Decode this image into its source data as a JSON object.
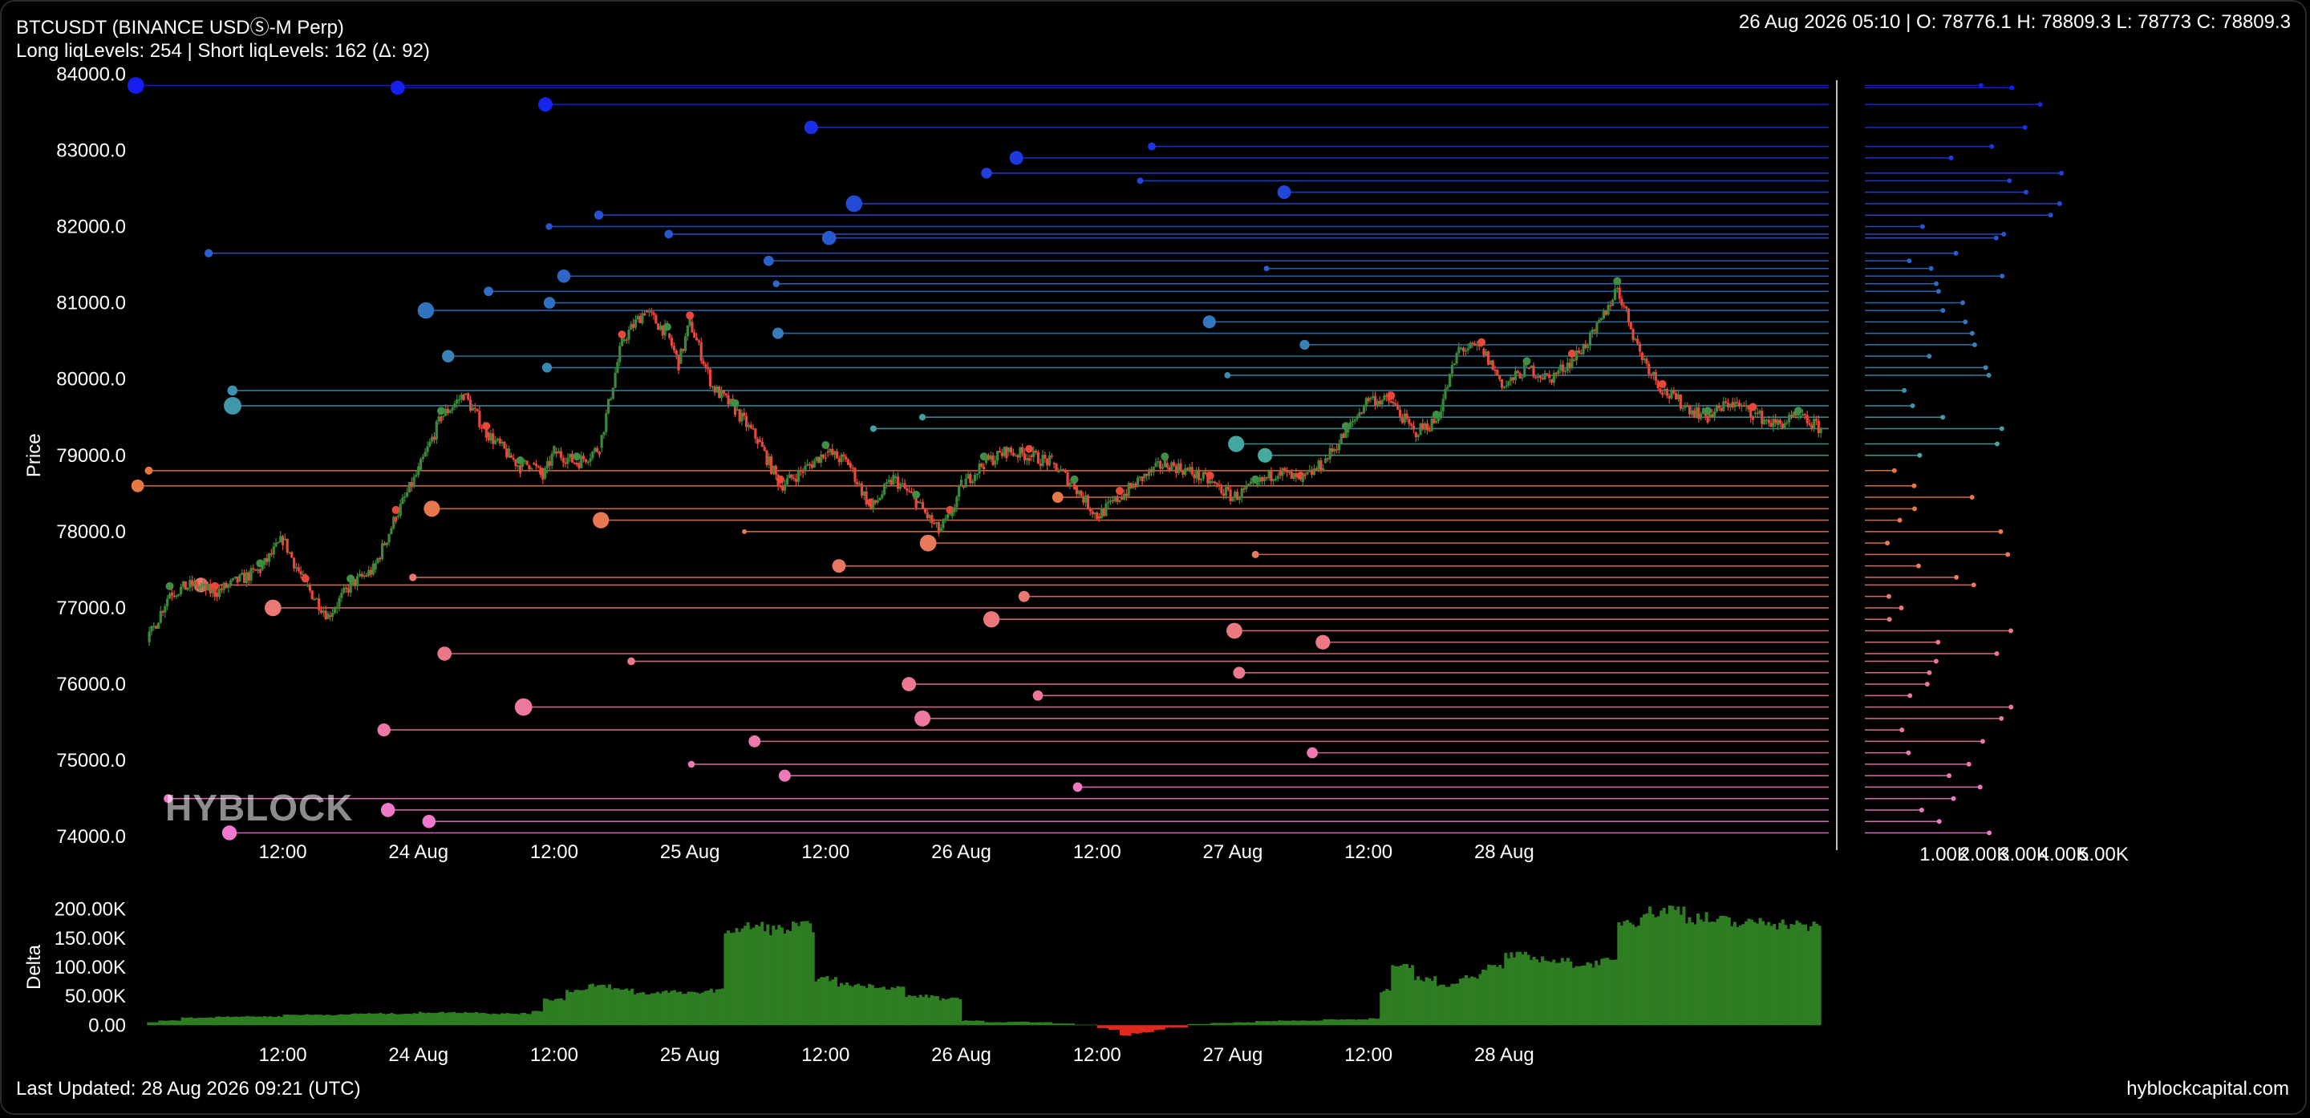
{
  "header": {
    "symbol": "BTCUSDT (BINANCE USDⓈ-M Perp)",
    "levels_summary": "Long liqLevels: 254 | Short liqLevels: 162 (Δ: 92)",
    "ohlc": "26 Aug 2026 05:10 | O: 78776.1 H: 78809.3 L: 78773 C: 78809.3"
  },
  "footer": {
    "last_updated": "Last Updated: 28 Aug 2026 09:21 (UTC)",
    "site": "hyblockcapital.com"
  },
  "watermark": "HYBLOCK",
  "colors": {
    "background": "#000000",
    "up_candle": "#3a8a3a",
    "down_candle": "#e8473a",
    "short_levels": "#1f2ee0",
    "long_levels": "#e88ab5",
    "delta_positive": "#2f7d23",
    "delta_negative": "#e0281c"
  },
  "chart_data": [
    {
      "type": "line",
      "title": "",
      "ylabel": "Price",
      "ylim": [
        73950,
        84150
      ],
      "y_ticks": [
        "84000.0",
        "83000.0",
        "82000.0",
        "81000.0",
        "80000.0",
        "79000.0",
        "78000.0",
        "77000.0",
        "76000.0",
        "75000.0",
        "74000.0"
      ],
      "x_ticks": [
        "12:00",
        "24 Aug",
        "12:00",
        "25 Aug",
        "12:00",
        "26 Aug",
        "12:00",
        "27 Aug",
        "12:00",
        "28 Aug"
      ],
      "x_tick_hours": [
        12,
        24,
        36,
        48,
        60,
        72,
        84,
        96,
        108,
        120
      ],
      "xlim_hours": [
        -1.3,
        148.7
      ],
      "series": [
        {
          "kind": "price",
          "x_hours": [
            0,
            2,
            4,
            6,
            8,
            10,
            12,
            14,
            16,
            18,
            20,
            22,
            24,
            26,
            28,
            30,
            32,
            33,
            34,
            35,
            36,
            38,
            40,
            42,
            44,
            46,
            47,
            48,
            50,
            52,
            54,
            56,
            58,
            60,
            62,
            64,
            66,
            68,
            70,
            71,
            72,
            74,
            76,
            78,
            80,
            82,
            84,
            86,
            88,
            90,
            92,
            94,
            96,
            98,
            100,
            102,
            104,
            106,
            108,
            110,
            112,
            114,
            116,
            118,
            120,
            122,
            124,
            126,
            128,
            130,
            132,
            134,
            136,
            138,
            140,
            142,
            144,
            146,
            148
          ],
          "y": [
            76550,
            77200,
            77300,
            77200,
            77350,
            77500,
            77900,
            77300,
            76900,
            77300,
            77500,
            78200,
            78800,
            79500,
            79800,
            79300,
            79000,
            78850,
            78900,
            78700,
            79050,
            78900,
            79100,
            80500,
            80900,
            80600,
            80200,
            80750,
            79900,
            79600,
            79200,
            78600,
            78800,
            79050,
            78900,
            78300,
            78700,
            78400,
            78000,
            78200,
            78600,
            78900,
            79050,
            79000,
            78900,
            78600,
            78200,
            78450,
            78700,
            78900,
            78800,
            78650,
            78450,
            78600,
            78800,
            78650,
            78900,
            79300,
            79750,
            79700,
            79300,
            79450,
            80400,
            80400,
            79900,
            80150,
            80000,
            80250,
            80600,
            81200,
            80350,
            79850,
            79650,
            79500,
            79700,
            79550,
            79400,
            79500,
            79350
          ]
        },
        {
          "kind": "liquidation_levels",
          "name": "Short liqLevels",
          "count": 162,
          "levels": [
            83850,
            83820,
            83600,
            83300,
            83050,
            82900,
            82700,
            82600,
            82450,
            82300,
            82150,
            82000,
            81900,
            81850,
            81650,
            81550,
            81450,
            81350,
            81250,
            81150,
            81000,
            80900,
            80750,
            80600,
            80450,
            80300,
            80150,
            80050,
            79850,
            79650,
            79500,
            79350,
            79150,
            79000
          ]
        },
        {
          "kind": "liquidation_levels",
          "name": "Long liqLevels",
          "count": 254,
          "levels": [
            78800,
            78600,
            78450,
            78300,
            78150,
            78000,
            77850,
            77700,
            77550,
            77400,
            77300,
            77150,
            77000,
            76850,
            76700,
            76550,
            76400,
            76300,
            76150,
            76000,
            75850,
            75700,
            75550,
            75400,
            75250,
            75100,
            74950,
            74800,
            74650,
            74500,
            74350,
            74200,
            74050
          ]
        }
      ]
    },
    {
      "type": "bar",
      "title": "",
      "ylabel": "",
      "xlim": [
        0.5,
        6.5
      ],
      "x_ticks": [
        "1.00K",
        "2.00K",
        "3.00K",
        "4.00K",
        "5.00K"
      ],
      "x_tick_values": [
        1,
        2,
        3,
        4,
        5
      ],
      "orientation": "horizontal",
      "note_units": "K"
    },
    {
      "type": "area",
      "title": "",
      "ylabel": "Delta",
      "ylim": [
        -30000,
        230000
      ],
      "y_ticks": [
        "200.00K",
        "150.00K",
        "100.00K",
        "50.00K",
        "0.00"
      ],
      "x_ticks": [
        "12:00",
        "24 Aug",
        "12:00",
        "25 Aug",
        "12:00",
        "26 Aug",
        "12:00",
        "27 Aug",
        "12:00",
        "28 Aug"
      ],
      "x_tick_hours": [
        12,
        24,
        36,
        48,
        60,
        72,
        84,
        96,
        108,
        120
      ],
      "x_hours": [
        0,
        1,
        3,
        6,
        12,
        18,
        24,
        30,
        34,
        35,
        37,
        39,
        41,
        43,
        45,
        47,
        49,
        51,
        53,
        55,
        57,
        59,
        61,
        63,
        65,
        67,
        70,
        72,
        74,
        76,
        78,
        80,
        82,
        84,
        85,
        86,
        87,
        88,
        89,
        90,
        92,
        94,
        96,
        98,
        100,
        104,
        108,
        109,
        110,
        112,
        114,
        116,
        118,
        120,
        122,
        124,
        126,
        128,
        130,
        132,
        134,
        136,
        138,
        140,
        142,
        144,
        146,
        148
      ],
      "values": [
        5000,
        8000,
        13000,
        15000,
        18000,
        20000,
        22000,
        20000,
        25000,
        45000,
        60000,
        68000,
        62000,
        55000,
        58000,
        55000,
        60000,
        165000,
        170000,
        165000,
        170000,
        80000,
        70000,
        68000,
        65000,
        50000,
        45000,
        8000,
        5000,
        6000,
        5000,
        3000,
        1000,
        -5000,
        -8000,
        -18000,
        -14000,
        -12000,
        -8000,
        -4000,
        2000,
        4000,
        5000,
        7000,
        8000,
        10000,
        12000,
        60000,
        100000,
        80000,
        70000,
        85000,
        100000,
        120000,
        115000,
        110000,
        105000,
        110000,
        180000,
        195000,
        200000,
        185000,
        180000,
        175000,
        180000,
        175000,
        170000,
        150000
      ]
    }
  ]
}
